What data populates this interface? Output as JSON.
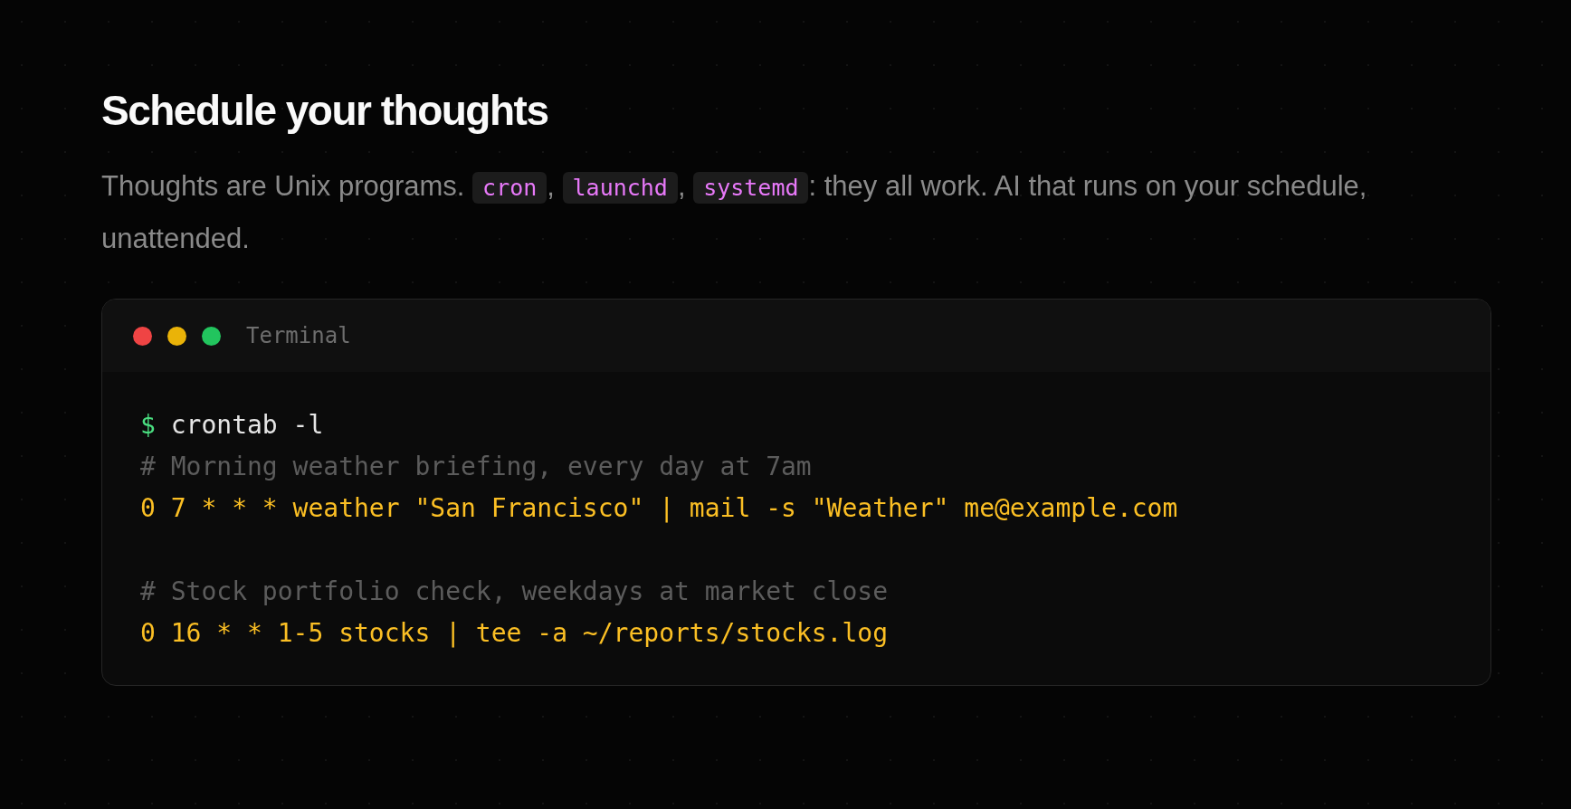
{
  "heading": "Schedule your thoughts",
  "description": [
    {
      "kind": "text",
      "text": "Thoughts are Unix programs. "
    },
    {
      "kind": "code",
      "text": "cron"
    },
    {
      "kind": "text",
      "text": ", "
    },
    {
      "kind": "code",
      "text": "launchd"
    },
    {
      "kind": "text",
      "text": ", "
    },
    {
      "kind": "code",
      "text": "systemd"
    },
    {
      "kind": "text",
      "text": ": they all work. AI that runs on your schedule, unattended."
    }
  ],
  "terminal": {
    "title": "Terminal",
    "lines": [
      {
        "kind": "prompt",
        "prompt": "$",
        "text": "crontab -l"
      },
      {
        "kind": "comment",
        "text": "# Morning weather briefing, every day at 7am"
      },
      {
        "kind": "command",
        "text": "0 7 * * * weather \"San Francisco\" | mail -s \"Weather\" me@example.com"
      },
      {
        "kind": "blank"
      },
      {
        "kind": "comment",
        "text": "# Stock portfolio check, weekdays at market close"
      },
      {
        "kind": "command",
        "text": "0 16 * * 1-5 stocks | tee -a ~/reports/stocks.log"
      }
    ]
  }
}
